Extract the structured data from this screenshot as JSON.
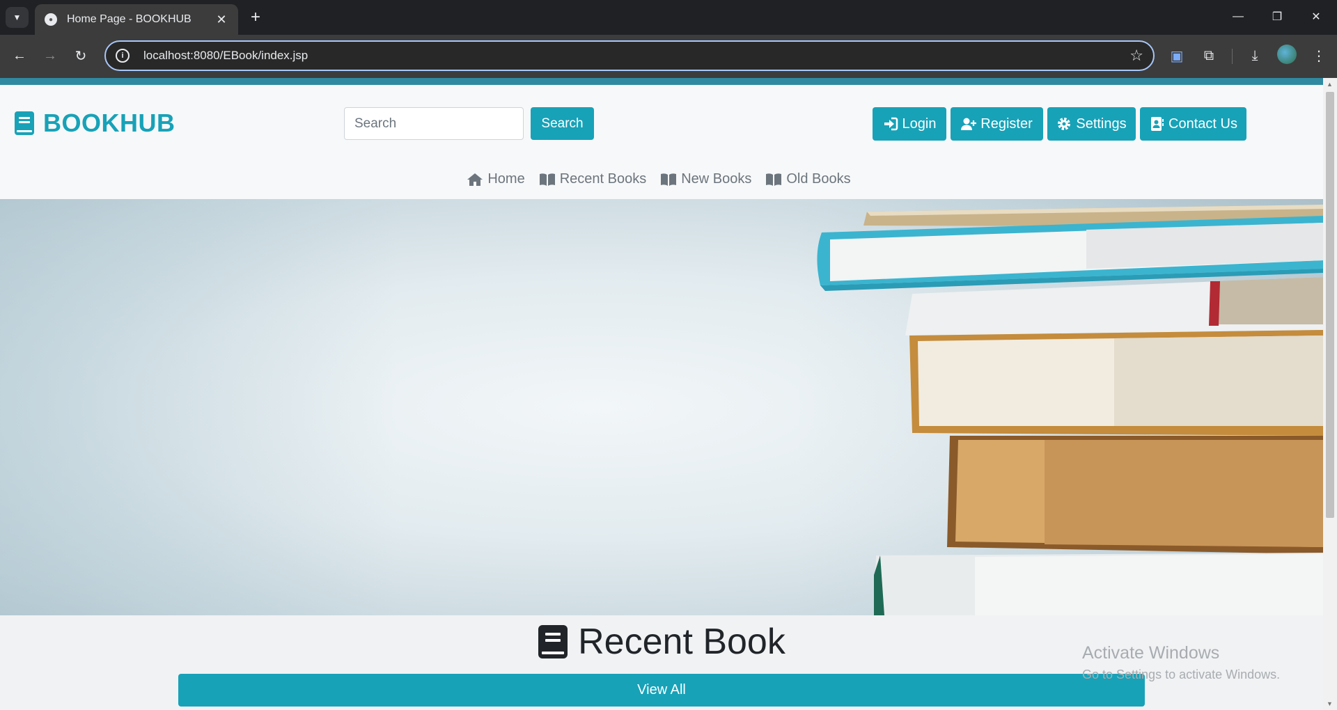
{
  "browser": {
    "tab_title": "Home Page - BOOKHUB",
    "url": "localhost:8080/EBook/index.jsp",
    "controls": {
      "minimize": "—",
      "maximize": "❐",
      "close": "✕"
    }
  },
  "site": {
    "brand": "BOOKHUB",
    "search": {
      "placeholder": "Search",
      "value": "",
      "button_label": "Search"
    },
    "actions": {
      "login": "Login",
      "register": "Register",
      "settings": "Settings",
      "contact": "Contact Us"
    },
    "menu": {
      "home": "Home",
      "recent": "Recent Books",
      "new": "New Books",
      "old": "Old Books"
    },
    "section": {
      "title": "Recent Book",
      "view_all": "View All"
    }
  },
  "os_watermark": {
    "title": "Activate Windows",
    "subtitle": "Go to Settings to activate Windows."
  },
  "colors": {
    "accent": "#17a2b8",
    "strip": "#2f8aa1",
    "text": "#212529",
    "muted": "#6c757d"
  }
}
